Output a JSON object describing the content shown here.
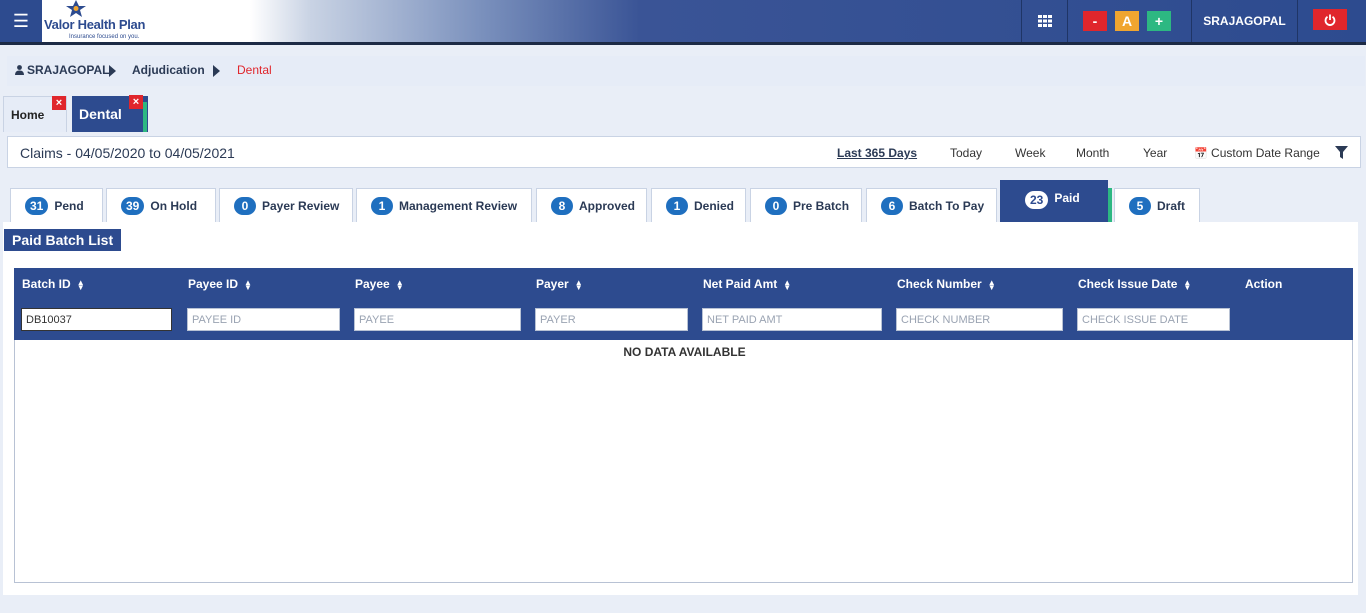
{
  "header": {
    "menu_icon": "hamburger-icon",
    "logo_name": "Valor Health Plan",
    "logo_tagline": "Insurance focused on you.",
    "grid_icon": "grid-icon",
    "font_decrease": "-",
    "font_reset": "A",
    "font_increase": "+",
    "username": "SRAJAGOPAL",
    "power_icon": "power-icon",
    "colors": {
      "bar": "#2d4b8f",
      "red": "#e0262c",
      "orange": "#f0a530",
      "green": "#2db882"
    }
  },
  "breadcrumb": {
    "user_icon": "user-icon",
    "items": [
      "SRAJAGOPAL",
      "Adjudication",
      "Dental"
    ],
    "active_color": "#e0262c"
  },
  "page_tabs": [
    {
      "label": "Home",
      "close": "×"
    },
    {
      "label": "Dental",
      "close": "×"
    }
  ],
  "claims_bar": {
    "title": "Claims - 04/05/2020 to 04/05/2021",
    "ranges": [
      "Last 365 Days",
      "Today",
      "Week",
      "Month",
      "Year"
    ],
    "custom_range": "Custom Date Range",
    "calendar_icon": "calendar-icon",
    "filter_icon": "filter-icon"
  },
  "status_tabs": [
    {
      "count": "31",
      "label": "Pend"
    },
    {
      "count": "39",
      "label": "On Hold"
    },
    {
      "count": "0",
      "label": "Payer Review"
    },
    {
      "count": "1",
      "label": "Management Review"
    },
    {
      "count": "8",
      "label": "Approved"
    },
    {
      "count": "1",
      "label": "Denied"
    },
    {
      "count": "0",
      "label": "Pre Batch"
    },
    {
      "count": "6",
      "label": "Batch To Pay"
    },
    {
      "count": "23",
      "label": "Paid"
    },
    {
      "count": "5",
      "label": "Draft"
    }
  ],
  "active_tab": "Paid",
  "list": {
    "title": "Paid Batch List",
    "columns": [
      "Batch ID",
      "Payee ID",
      "Payee",
      "Payer",
      "Net Paid Amt",
      "Check Number",
      "Check Issue Date",
      "Action"
    ],
    "filters": {
      "batch_id_value": "DB10037",
      "payee_id_placeholder": "PAYEE ID",
      "payee_placeholder": "PAYEE",
      "payer_placeholder": "PAYER",
      "net_paid_placeholder": "NET PAID AMT",
      "check_number_placeholder": "CHECK NUMBER",
      "check_issue_date_placeholder": "CHECK ISSUE DATE"
    },
    "empty_message": "NO DATA AVAILABLE"
  }
}
